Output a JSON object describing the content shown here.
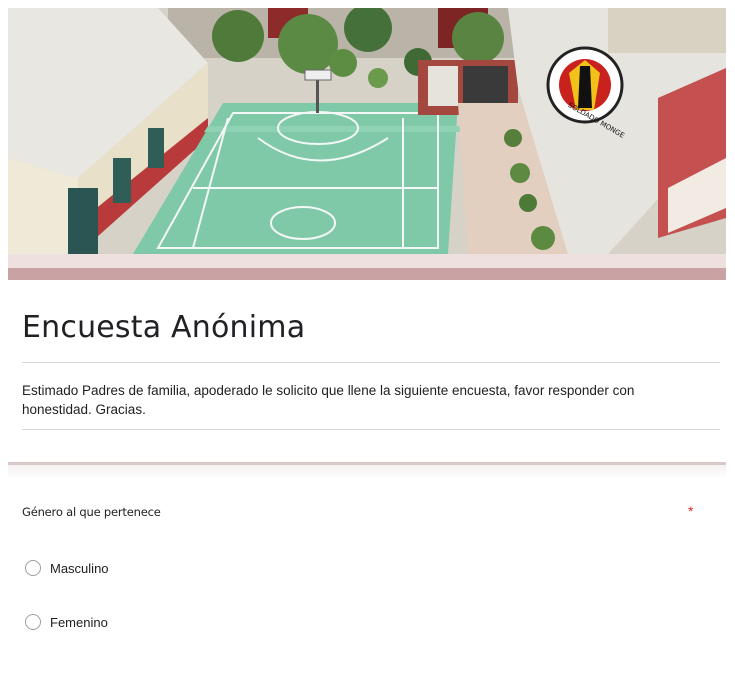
{
  "header": {
    "image_name": "school-courtyard-banner",
    "logo_text": "SOLDADO MONGE"
  },
  "form": {
    "title": "Encuesta Anónima",
    "description": "Estimado Padres de familia, apoderado le solicito que llene la siguiente encuesta, favor responder con honestidad. Gracias."
  },
  "question": {
    "label": "Género al que pertenece",
    "required_mark": "*",
    "options": [
      {
        "label": "Masculino",
        "selected": false
      },
      {
        "label": "Femenino",
        "selected": false
      }
    ]
  },
  "colors": {
    "banner_strip": "#c9a3a3",
    "required": "#d93025",
    "court": "#7fc9a9"
  }
}
